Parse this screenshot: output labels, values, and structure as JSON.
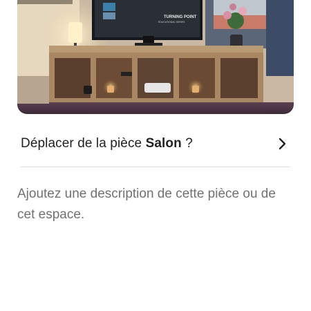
{
  "photo": {
    "tv_text_line1": "TURNING POINT",
    "tv_text_line2": "EDUCATIONAL SERIES"
  },
  "move_room": {
    "prefix": "Déplacer de la pièce ",
    "room_name": "Salon",
    "suffix": " ?",
    "icon": "chevron-right-icon"
  },
  "description": {
    "placeholder": "Ajoutez une description de cette pièce ou de cet espace."
  }
}
